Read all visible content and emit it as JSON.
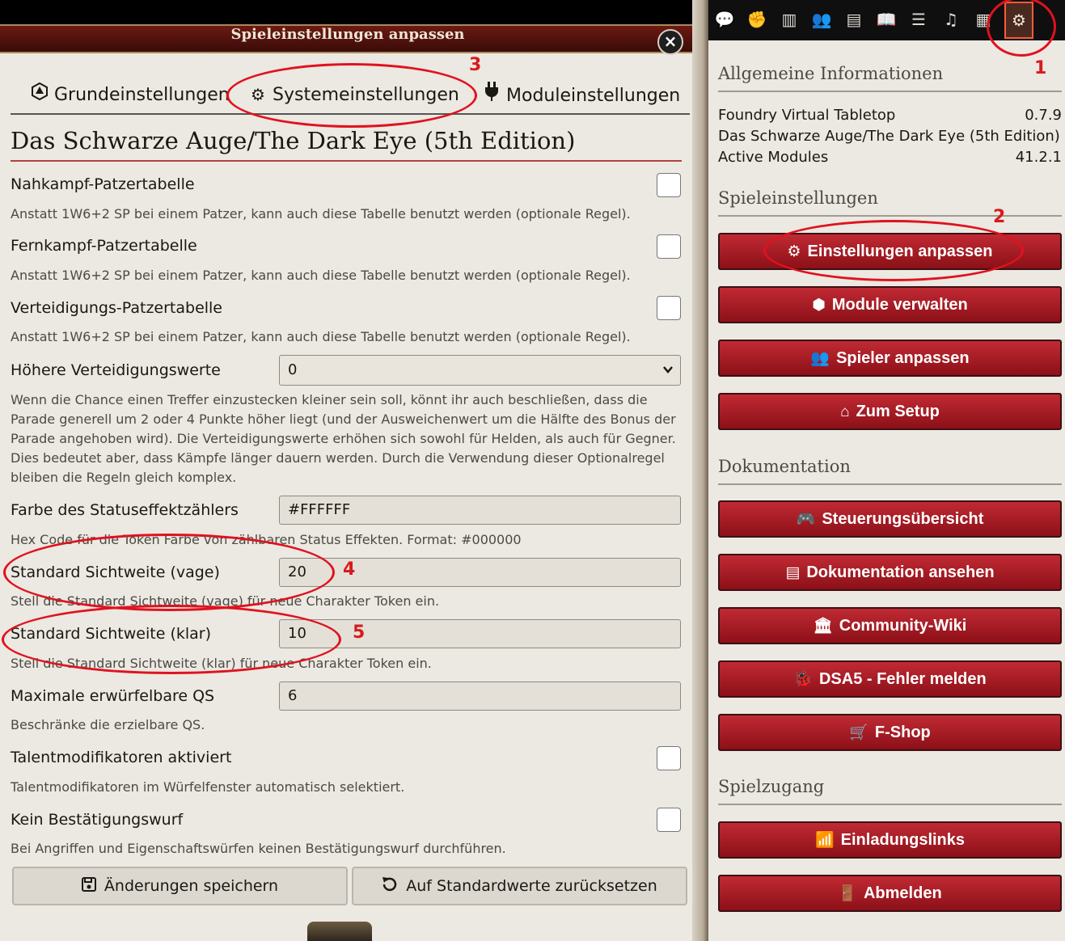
{
  "dialog": {
    "title": "Spieleinstellungen anpassen",
    "close_icon": "×",
    "tabs": [
      {
        "label": "Grundeinstellungen",
        "icon": "d20-icon",
        "glyph": "⬡"
      },
      {
        "label": "Systemeinstellungen",
        "icon": "cogs-icon",
        "glyph": "⚙"
      },
      {
        "label": "Moduleinstellungen",
        "icon": "plug-icon",
        "glyph": "🔌"
      }
    ],
    "system_title": "Das Schwarze Auge/The Dark Eye (5th Edition)",
    "settings": {
      "melee": {
        "label": "Nahkampf-Patzertabelle",
        "hint": "Anstatt 1W6+2 SP bei einem Patzer, kann auch diese Tabelle benutzt werden (optionale Regel)."
      },
      "ranged": {
        "label": "Fernkampf-Patzertabelle",
        "hint": "Anstatt 1W6+2 SP bei einem Patzer, kann auch diese Tabelle benutzt werden (optionale Regel)."
      },
      "defense": {
        "label": "Verteidigungs-Patzertabelle",
        "hint": "Anstatt 1W6+2 SP bei einem Patzer, kann auch diese Tabelle benutzt werden (optionale Regel)."
      },
      "higher_defense": {
        "label": "Höhere Verteidigungswerte",
        "value": "0",
        "hint": "Wenn die Chance einen Treffer einzustecken kleiner sein soll, könnt ihr auch beschließen, dass die Parade generell um 2 oder 4 Punkte höher liegt (und der Ausweichenwert um die Hälfte des Bonus der Parade angehoben wird). Die Verteidigungswerte erhöhen sich sowohl für Helden, als auch für Gegner. Dies bedeutet aber, dass Kämpfe länger dauern werden. Durch die Verwendung dieser Optionalregel bleiben die Regeln gleich komplex."
      },
      "status_color": {
        "label": "Farbe des Statuseffektzählers",
        "value": "#FFFFFF",
        "hint": "Hex Code für die Token Farbe von zählbaren Status Effekten. Format: #000000"
      },
      "sight_dim": {
        "label": "Standard Sichtweite (vage)",
        "value": "20",
        "hint": "Stell die Standard Sichtweite (vage) für neue Charakter Token ein."
      },
      "sight_bright": {
        "label": "Standard Sichtweite (klar)",
        "value": "10",
        "hint": "Stell die Standard Sichtweite (klar) für neue Charakter Token ein."
      },
      "max_qs": {
        "label": "Maximale erwürfelbare QS",
        "value": "6",
        "hint": "Beschränke die erzielbare QS."
      },
      "talent_mods": {
        "label": "Talentmodifikatoren aktiviert",
        "hint": "Talentmodifikatoren im Würfelfenster automatisch selektiert."
      },
      "no_confirm": {
        "label": "Kein Bestätigungswurf",
        "hint": "Bei Angriffen und Eigenschaftswürfen keinen Bestätigungswurf durchführen."
      }
    },
    "save_label": "Änderungen speichern",
    "reset_label": "Auf Standardwerte zurücksetzen"
  },
  "annotations": {
    "one": "1",
    "two": "2",
    "three": "3",
    "four": "4",
    "five": "5",
    "color": "#e0121e"
  },
  "sidebar": {
    "tab_icons": [
      "chat-icon",
      "combat-icon",
      "map-icon",
      "actors-icon",
      "items-icon",
      "journal-icon",
      "tables-icon",
      "playlist-icon",
      "compendium-icon",
      "settings-icon"
    ],
    "general_header": "Allgemeine Informationen",
    "info": [
      {
        "name": "Foundry Virtual Tabletop",
        "value": "0.7.9"
      },
      {
        "name": "Das Schwarze Auge/The Dark Eye (5th Edition)",
        "value": ""
      },
      {
        "name": "Active Modules",
        "value": "41.2.1"
      }
    ],
    "game_settings_header": "Spieleinstellungen",
    "settings_buttons": [
      {
        "label": "Einstellungen anpassen",
        "icon": "cogs-icon"
      },
      {
        "label": "Module verwalten",
        "icon": "cube-icon"
      },
      {
        "label": "Spieler anpassen",
        "icon": "users-icon"
      },
      {
        "label": "Zum Setup",
        "icon": "home-icon"
      }
    ],
    "docs_header": "Dokumentation",
    "docs_buttons": [
      {
        "label": "Steuerungsübersicht",
        "icon": "gamepad-icon"
      },
      {
        "label": "Dokumentation ansehen",
        "icon": "book-icon"
      },
      {
        "label": "Community-Wiki",
        "icon": "landmark-icon"
      },
      {
        "label": "DSA5 - Fehler melden",
        "icon": "bug-icon"
      },
      {
        "label": "F-Shop",
        "icon": "cart-icon"
      }
    ],
    "access_header": "Spielzugang",
    "access_buttons": [
      {
        "label": "Einladungslinks",
        "icon": "wifi-icon"
      },
      {
        "label": "Abmelden",
        "icon": "door-icon"
      }
    ],
    "button_color": "#a8141f"
  }
}
